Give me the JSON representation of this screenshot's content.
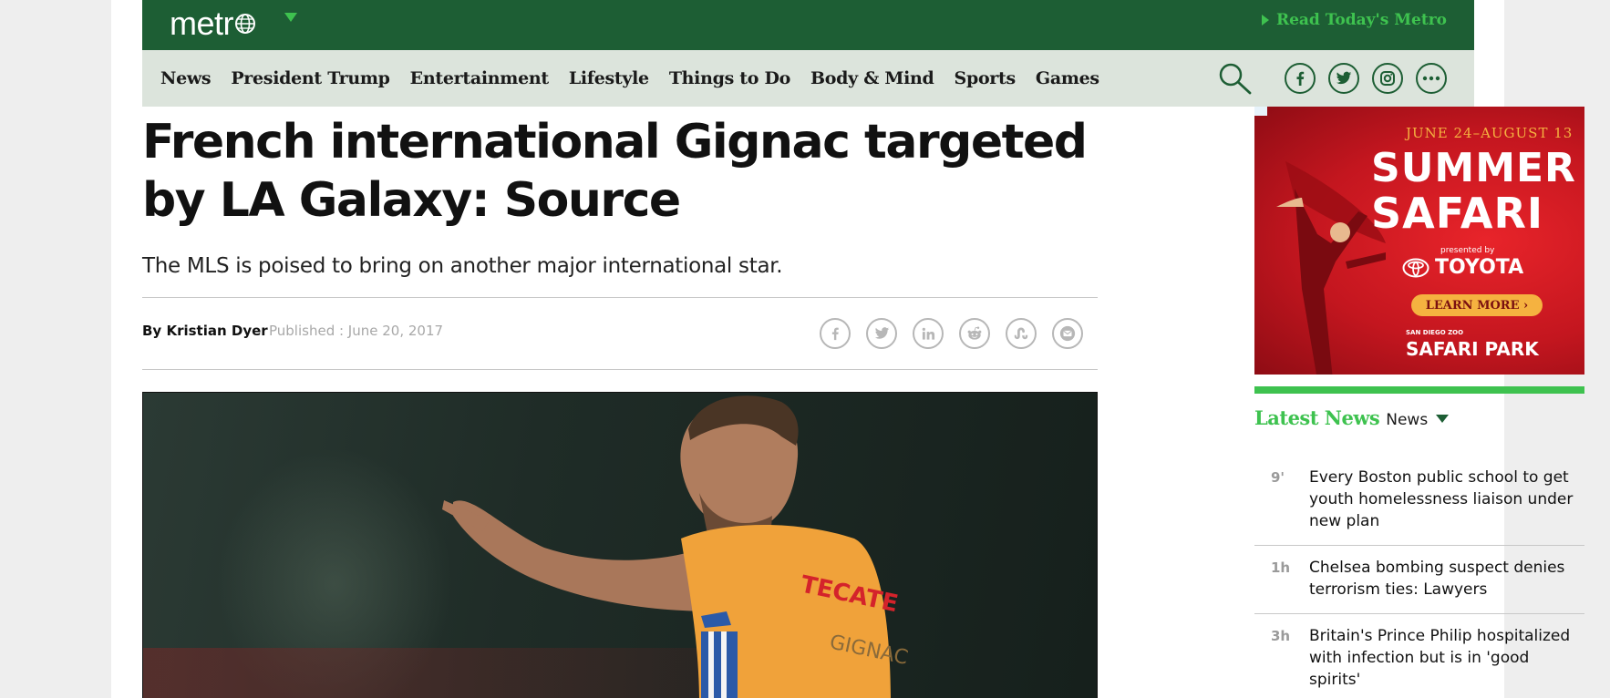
{
  "header": {
    "logo": "metr",
    "read_today": "Read Today's Metro"
  },
  "nav": {
    "items": [
      "News",
      "President Trump",
      "Entertainment",
      "Lifestyle",
      "Things to Do",
      "Body & Mind",
      "Sports",
      "Games"
    ],
    "icons": [
      "search-icon",
      "facebook-icon",
      "twitter-icon",
      "instagram-icon",
      "more-icon"
    ]
  },
  "article": {
    "headline": "French international Gignac targeted by LA Galaxy: Source",
    "subhead": "The MLS is poised to bring on another major international star.",
    "byline_prefix": "By",
    "author": "Kristian Dyer",
    "published": "Published : June 20, 2017",
    "share_icons": [
      "facebook-icon",
      "twitter-icon",
      "linkedin-icon",
      "reddit-icon",
      "stumbleupon-icon",
      "email-icon"
    ]
  },
  "ad": {
    "date": "JUNE 24–AUGUST 13",
    "title_line1": "SUMMER",
    "title_line2": "SAFARI",
    "presented_by": "presented by",
    "sponsor": "TOYOTA",
    "cta": "LEARN MORE",
    "zoo": "SAN DIEGO ZOO",
    "park": "SAFARI PARK"
  },
  "sidebar": {
    "latest_label": "Latest News",
    "category": "News",
    "items": [
      {
        "time": "9'",
        "title": "Every Boston public school to get youth homelessness liaison under new plan"
      },
      {
        "time": "1h",
        "title": "Chelsea bombing suspect denies terrorism ties: Lawyers"
      },
      {
        "time": "3h",
        "title": "Britain's Prince Philip hospitalized with infection but is in 'good spirits'"
      }
    ]
  },
  "colors": {
    "brand_dark_green": "#1d5e34",
    "accent_green": "#3ec24f",
    "nav_bg": "#dce4dc"
  }
}
